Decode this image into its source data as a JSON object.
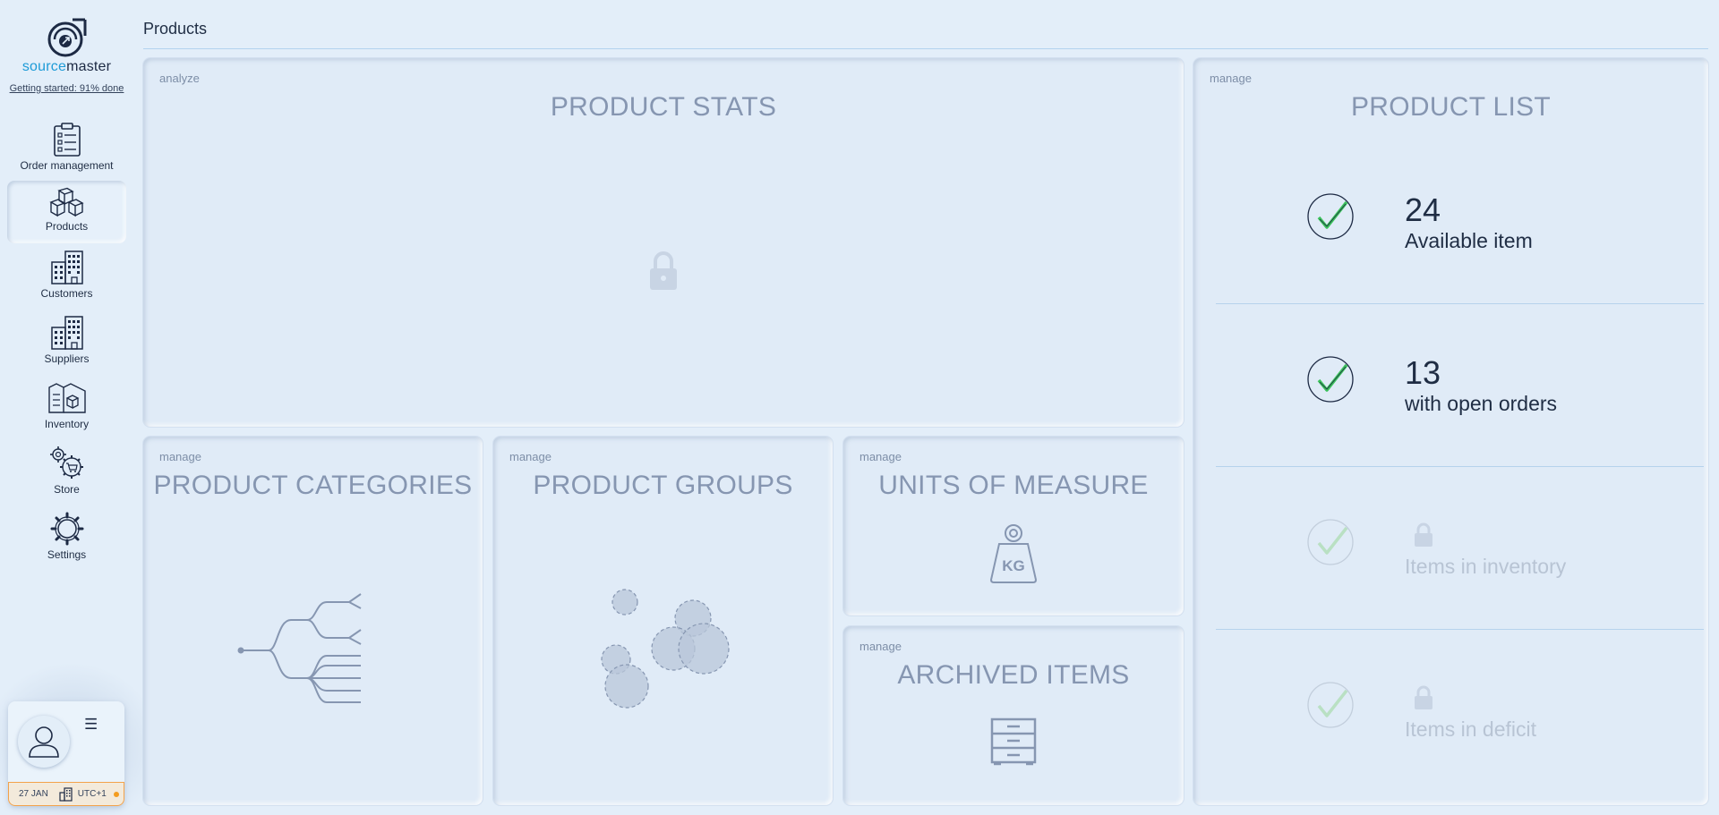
{
  "sidebar": {
    "brand_part1": "source",
    "brand_part2": "master",
    "getting_started": "Getting started: 91% done",
    "items": [
      {
        "label": "Order management",
        "icon": "clipboard-icon"
      },
      {
        "label": "Products",
        "icon": "boxes-icon",
        "active": true
      },
      {
        "label": "Customers",
        "icon": "building-icon"
      },
      {
        "label": "Suppliers",
        "icon": "building-icon"
      },
      {
        "label": "Inventory",
        "icon": "warehouse-icon"
      },
      {
        "label": "Store",
        "icon": "store-gears-icon"
      },
      {
        "label": "Settings",
        "icon": "gear-icon"
      }
    ]
  },
  "user": {
    "date": "27 JAN",
    "timezone": "UTC+1",
    "status_color": "#f39c1f"
  },
  "header": {
    "title": "Products"
  },
  "panels": {
    "stats": {
      "kicker": "analyze",
      "title": "PRODUCT STATS",
      "icon": "lock-icon"
    },
    "categories": {
      "kicker": "manage",
      "title": "PRODUCT CATEGORIES",
      "icon": "tree-icon"
    },
    "groups": {
      "kicker": "manage",
      "title": "PRODUCT GROUPS",
      "icon": "bubbles-icon"
    },
    "uom": {
      "kicker": "manage",
      "title": "UNITS OF MEASURE",
      "icon": "weight-icon",
      "weight_label": "KG"
    },
    "archived": {
      "kicker": "manage",
      "title": "ARCHIVED ITEMS",
      "icon": "cabinet-icon"
    },
    "list": {
      "kicker": "manage",
      "title": "PRODUCT LIST",
      "rows": [
        {
          "count": "24",
          "label": "Available item",
          "locked": false
        },
        {
          "count": "13",
          "label": "with open orders",
          "locked": false
        },
        {
          "label": "Items in inventory",
          "locked": true
        },
        {
          "label": "Items in deficit",
          "locked": true
        }
      ]
    }
  },
  "colors": {
    "background": "#e3eef9",
    "accent": "#1e9bd7",
    "check_green": "#3ac25a",
    "muted_title": "#8696b1"
  }
}
